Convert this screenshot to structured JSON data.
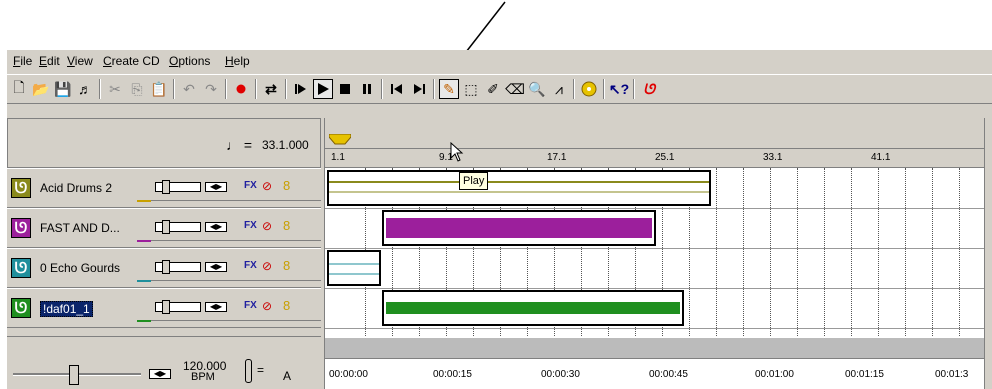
{
  "menu": [
    "File",
    "Edit",
    "View",
    "Create CD",
    "Options",
    "Help"
  ],
  "toolbar": {
    "buttons": [
      "new-icon",
      "open-icon",
      "save-icon",
      "render-icon",
      "cut-icon",
      "copy-icon",
      "paste-icon",
      "undo-icon",
      "redo-icon",
      "record-icon",
      "loop-icon",
      "play-from-start-icon",
      "play-icon",
      "stop-icon",
      "pause-icon",
      "go-to-start-icon",
      "go-to-end-icon",
      "draw-tool-icon",
      "envelope-tool-icon",
      "selection-tool-icon",
      "erase-tool-icon",
      "zoom-tool-icon",
      "envelope-edit-icon",
      "cd-icon",
      "whats-this-icon",
      "acid-logo-icon"
    ],
    "tooltip": "Play"
  },
  "tempo_header": {
    "beat_value": "33.1.000"
  },
  "tracks": [
    {
      "name": "Acid Drums 2",
      "color": "#8a8a1c",
      "underline": "#c8a000",
      "fx": "FX"
    },
    {
      "name": "FAST AND D...",
      "color": "#9c1f9c",
      "underline": "#9c1f9c",
      "fx": "FX"
    },
    {
      "name": "0 Echo Gourds",
      "color": "#1f8f9c",
      "underline": "#1f8f9c",
      "fx": "FX"
    },
    {
      "name": "!daf01_1",
      "color": "#1f8f1f",
      "underline": "#1f8f1f",
      "fx": "FX"
    }
  ],
  "ruler": [
    "1.1",
    "9.1",
    "17.1",
    "25.1",
    "33.1",
    "41.1"
  ],
  "time_marks": [
    "00:00:00",
    "00:00:15",
    "00:00:30",
    "00:00:45",
    "00:01:00",
    "00:01:15",
    "00:01:3"
  ],
  "transport": {
    "tempo": "120.000",
    "unit": "BPM",
    "key": "A"
  },
  "colors": {
    "clip1": "#8a8a1c",
    "clip2": "#9c1f9c",
    "clip3": "#1f8f9c",
    "clip4": "#1f8f1f",
    "record": "#e00000"
  }
}
